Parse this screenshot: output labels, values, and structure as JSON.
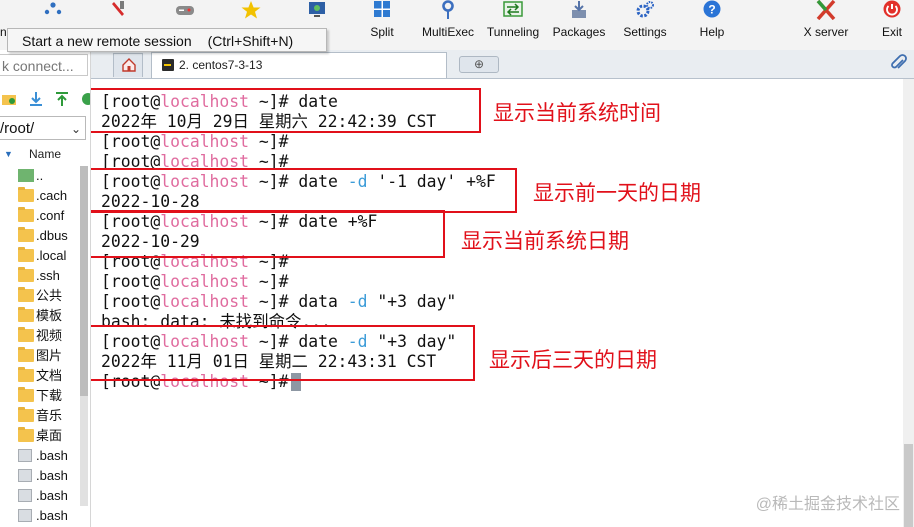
{
  "toolbar": {
    "buttons": [
      {
        "label": "Split",
        "icon": "split-icon"
      },
      {
        "label": "MultiExec",
        "icon": "multiexec-icon"
      },
      {
        "label": "Tunneling",
        "icon": "tunneling-icon"
      },
      {
        "label": "Packages",
        "icon": "packages-icon"
      },
      {
        "label": "Settings",
        "icon": "settings-icon"
      },
      {
        "label": "Help",
        "icon": "help-icon"
      },
      {
        "label": "X server",
        "icon": "x-server-icon"
      },
      {
        "label": "Exit",
        "icon": "exit-icon"
      }
    ],
    "partial_left_label": "n",
    "partial_view_label": "w"
  },
  "tooltip": {
    "text": "Start a new remote session",
    "shortcut": "(Ctrl+Shift+N)"
  },
  "quick_connect": {
    "placeholder": "k connect..."
  },
  "sftp": {
    "path": "/root/",
    "column_header": "Name",
    "files": [
      {
        "name": "..",
        "type": "up"
      },
      {
        "name": ".cach",
        "type": "folder"
      },
      {
        "name": ".conf",
        "type": "folder"
      },
      {
        "name": ".dbus",
        "type": "folder"
      },
      {
        "name": ".local",
        "type": "folder"
      },
      {
        "name": ".ssh",
        "type": "folder"
      },
      {
        "name": "公共",
        "type": "folder"
      },
      {
        "name": "模板",
        "type": "folder"
      },
      {
        "name": "视频",
        "type": "folder"
      },
      {
        "name": "图片",
        "type": "folder"
      },
      {
        "name": "文档",
        "type": "folder"
      },
      {
        "name": "下载",
        "type": "folder"
      },
      {
        "name": "音乐",
        "type": "folder"
      },
      {
        "name": "桌面",
        "type": "folder"
      },
      {
        "name": ".bash",
        "type": "file"
      },
      {
        "name": ".bash",
        "type": "file"
      },
      {
        "name": ".bash",
        "type": "file"
      },
      {
        "name": ".bash",
        "type": "file"
      }
    ]
  },
  "tabs": {
    "session_label": "2. centos7-3-13",
    "new_tab_symbol": "⊕"
  },
  "terminal": {
    "lines": [
      {
        "prompt_pre": "[root@",
        "host": "localhost",
        "prompt_post": " ~]# ",
        "cmd": "date",
        "opt": "",
        "rest": ""
      },
      {
        "output": "2022年 10月 29日 星期六 22:42:39 CST"
      },
      {
        "prompt_pre": "[root@",
        "host": "localhost",
        "prompt_post": " ~]#",
        "cmd": "",
        "opt": "",
        "rest": ""
      },
      {
        "prompt_pre": "[root@",
        "host": "localhost",
        "prompt_post": " ~]#",
        "cmd": "",
        "opt": "",
        "rest": ""
      },
      {
        "prompt_pre": "[root@",
        "host": "localhost",
        "prompt_post": " ~]# ",
        "cmd": "date ",
        "opt": "-d",
        "rest": " '-1 day' +%F"
      },
      {
        "output": "2022-10-28"
      },
      {
        "prompt_pre": "[root@",
        "host": "localhost",
        "prompt_post": " ~]# ",
        "cmd": "date +%F",
        "opt": "",
        "rest": ""
      },
      {
        "output": "2022-10-29"
      },
      {
        "prompt_pre": "[root@",
        "host": "localhost",
        "prompt_post": " ~]#",
        "cmd": "",
        "opt": "",
        "rest": ""
      },
      {
        "prompt_pre": "[root@",
        "host": "localhost",
        "prompt_post": " ~]#",
        "cmd": "",
        "opt": "",
        "rest": ""
      },
      {
        "prompt_pre": "[root@",
        "host": "localhost",
        "prompt_post": " ~]# ",
        "cmd": "data ",
        "opt": "-d",
        "rest": " \"+3 day\""
      },
      {
        "output": "bash: data: 未找到命令..."
      },
      {
        "prompt_pre": "[root@",
        "host": "localhost",
        "prompt_post": " ~]# ",
        "cmd": "date ",
        "opt": "-d",
        "rest": " \"+3 day\""
      },
      {
        "output": "2022年 11月 01日 星期二 22:43:31 CST"
      },
      {
        "prompt_pre": "[root@",
        "host": "localhost",
        "prompt_post": " ~]#",
        "cmd": "",
        "opt": "",
        "rest": "",
        "cursor": true
      }
    ],
    "annotations": [
      "显示当前系统时间",
      "显示前一天的日期",
      "显示当前系统日期",
      "显示后三天的日期"
    ]
  },
  "watermark": "@稀土掘金技术社区",
  "colors": {
    "annotation_red": "#e1101a",
    "hostname_pink": "#e06c9f",
    "option_blue": "#3b9cd8"
  }
}
